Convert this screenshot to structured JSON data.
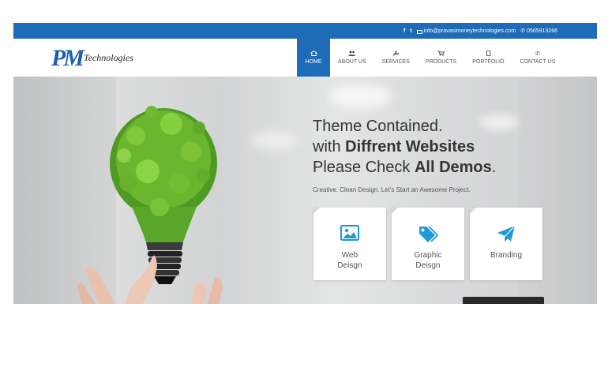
{
  "topbar": {
    "facebook_icon": "f",
    "twitter_icon": "t",
    "email": "info@pravasimoneytechnologies.com",
    "phone": "0565913266",
    "color": "#1e6bb8"
  },
  "logo": {
    "mark": "PM",
    "word": "Technologies"
  },
  "menu": [
    {
      "label": "HOME",
      "icon": "home-icon",
      "active": true
    },
    {
      "label": "ABOUT US",
      "icon": "users-icon"
    },
    {
      "label": "SERVICES",
      "icon": "wrench-icon"
    },
    {
      "label": "PRODUCTS",
      "icon": "cart-icon"
    },
    {
      "label": "PORTFOLIO",
      "icon": "document-icon"
    },
    {
      "label": "CONTACT US",
      "icon": "phone-icon"
    }
  ],
  "hero": {
    "line1": "Theme Contained.",
    "line2_pre": "with ",
    "line2_bold": "Diffrent Websites",
    "line3_pre": "Please Check ",
    "line3_bold": "All Demos",
    "line3_post": ".",
    "tagline": "Creative. Clean Design. Let's Start an Awesome Project."
  },
  "cards": [
    {
      "line1": "Web",
      "line2": "Deisgn",
      "icon": "image-icon"
    },
    {
      "line1": "Graphic",
      "line2": "Deisgn",
      "icon": "tags-icon"
    },
    {
      "line1": "Branding",
      "line2": "",
      "icon": "paper-plane-icon"
    }
  ],
  "accent": "#1e9ad6"
}
